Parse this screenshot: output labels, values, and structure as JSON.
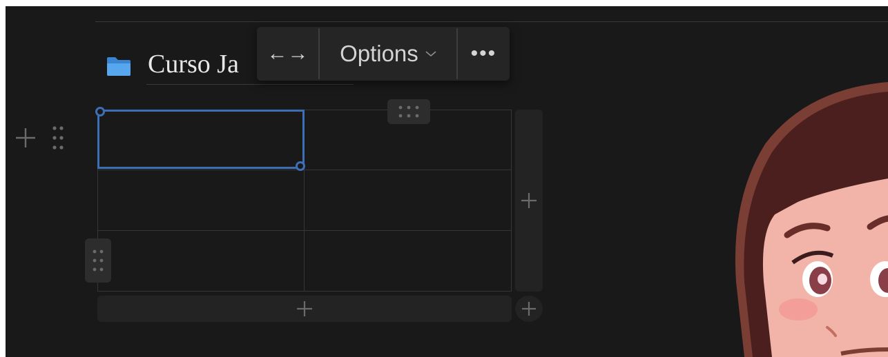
{
  "page": {
    "title": "Curso Ja",
    "icon": "folder-icon"
  },
  "toolbar": {
    "width_toggle_label": "←→",
    "options_label": "Options",
    "more_label": "•••"
  },
  "table": {
    "rows": 3,
    "columns": 2,
    "cells": [
      [
        "",
        ""
      ],
      [
        "",
        ""
      ],
      [
        "",
        ""
      ]
    ]
  },
  "colors": {
    "background": "#191919",
    "selection": "#3d6fb6",
    "folder": "#4a9de6",
    "text": "#e8e8e8"
  },
  "icons": {
    "add_row": "plus-icon",
    "drag": "drag-handle-icon",
    "options_caret": "chevron-down-icon"
  }
}
